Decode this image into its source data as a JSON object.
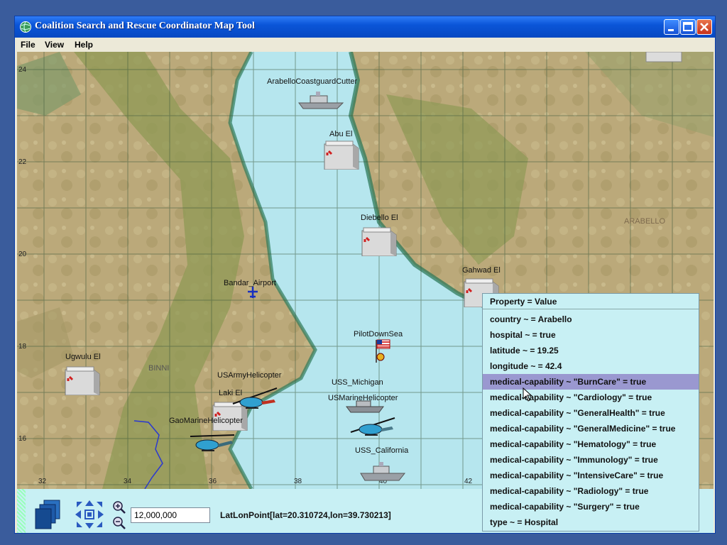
{
  "window": {
    "title": "Coalition Search and Rescue Coordinator Map Tool"
  },
  "menu": {
    "file": "File",
    "view": "View",
    "help": "Help"
  },
  "map": {
    "region_labels": {
      "arabello": "ARABELLO",
      "binni": "BINNI"
    },
    "lat_ticks": [
      "24",
      "22",
      "20",
      "18",
      "16"
    ],
    "lon_ticks": [
      "32",
      "34",
      "36",
      "38",
      "40",
      "42"
    ],
    "assets": {
      "cutter": "ArabelloCoastguardCutter",
      "abu": "Abu El",
      "diebello": "Diebello El",
      "gahwad": "Gahwad El",
      "bandar": "Bandar_Airport",
      "pilot": "PilotDownSea",
      "ugwulu": "Ugwulu El",
      "usarmy": "USArmyHelicopter",
      "laki": "Laki El",
      "gaomarine": "GaoMarineHelicopter",
      "michigan": "USS_Michigan",
      "usmarine": "USMarineHelicopter",
      "california": "USS_California"
    }
  },
  "popup": {
    "header": "Property = Value",
    "rows": [
      "country  ~ = Arabello",
      "hospital  ~ = true",
      "latitude  ~ = 19.25",
      "longitude  ~ = 42.4",
      "medical-capability  ~  \"BurnCare\" = true",
      "medical-capability  ~  \"Cardiology\" = true",
      "medical-capability  ~  \"GeneralHealth\" = true",
      "medical-capability  ~  \"GeneralMedicine\" = true",
      "medical-capability  ~  \"Hematology\" = true",
      "medical-capability  ~  \"Immunology\" = true",
      "medical-capability  ~  \"IntensiveCare\" = true",
      "medical-capability  ~  \"Radiology\" = true",
      "medical-capability  ~  \"Surgery\" = true",
      "type  ~ = Hospital"
    ],
    "selected_index": 4
  },
  "toolbar": {
    "scale_value": "12,000,000",
    "coordinates": "LatLonPoint[lat=20.310724,lon=39.730213]"
  },
  "colors": {
    "sea": "#b6e6ee",
    "land": "#b8a878",
    "highland": "#8f9a55",
    "coast": "#2f7a5a",
    "panel": "#c8f0f4",
    "selection": "#9a98d0"
  },
  "icons": [
    "layers-icon",
    "pan-arrows-icon",
    "zoom-in-icon",
    "zoom-out-icon",
    "building-icon",
    "helicopter-icon",
    "ship-icon",
    "airplane-icon",
    "flag-icon",
    "cursor-icon"
  ]
}
